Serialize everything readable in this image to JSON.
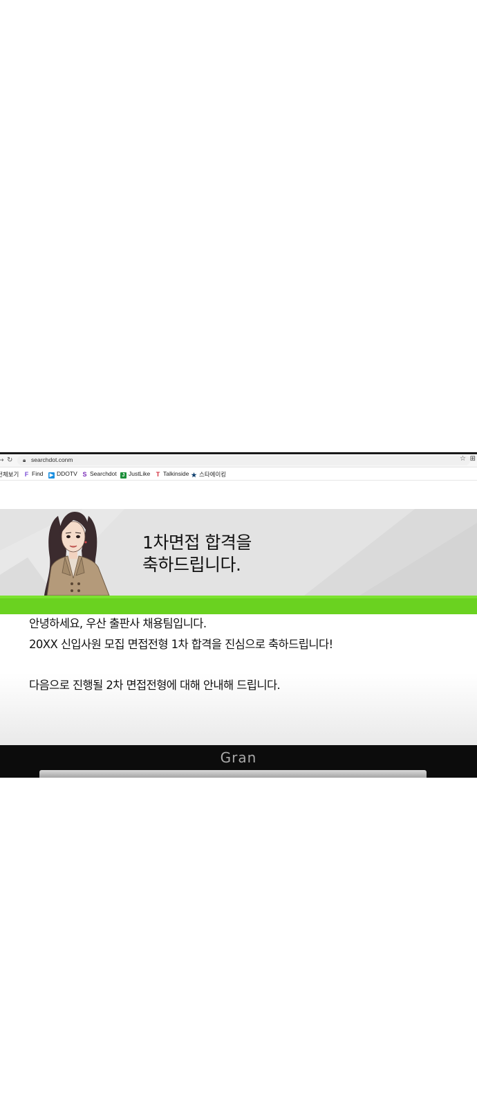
{
  "browser": {
    "url": "searchdot.conm",
    "bookmarks": [
      {
        "label": "전체보기",
        "icon": "none"
      },
      {
        "label": "Find",
        "icon": "find-icon"
      },
      {
        "label": "DDOTV",
        "icon": "play-icon"
      },
      {
        "label": "Searchdot",
        "icon": "searchdot-icon"
      },
      {
        "label": "JustLike",
        "icon": "justlike-icon"
      },
      {
        "label": "Talkinside",
        "icon": "talkinside-icon"
      },
      {
        "label": "스타에이킹",
        "icon": "star-icon"
      }
    ]
  },
  "banner": {
    "headline_line1": "1차면접 합격을",
    "headline_line2": "축하드립니다."
  },
  "body": {
    "line1": "안녕하세요, 우산 출판사 채용팀입니다.",
    "line2": "20XX 신입사원 모집 면접전형 1차 합격을 진심으로 축하드립니다!",
    "line3": "다음으로 진행될 2차 면접전형에 대해 안내해 드립니다."
  },
  "device": {
    "logo": "Gran"
  },
  "colors": {
    "accent_green": "#6ad220",
    "banner_bg": "#e2e2e2",
    "bezel": "#0c0c0c"
  }
}
